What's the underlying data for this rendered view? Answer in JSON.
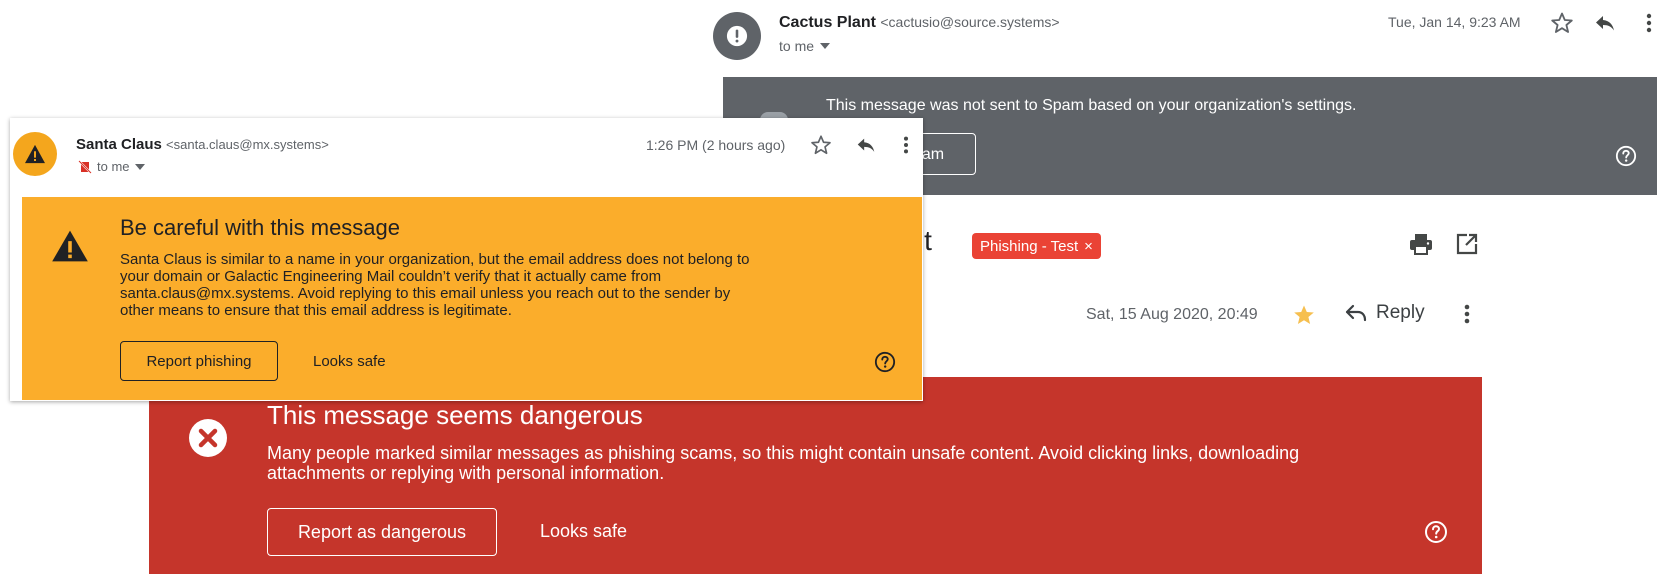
{
  "back_email": {
    "sender_name": "Cactus Plant",
    "sender_address": "<cactusio@source.systems>",
    "recipient": "to me",
    "date": "Tue, Jan 14, 9:23 AM",
    "notice": {
      "text": "This message was not sent to Spam based on your organization's settings.",
      "button_label": "pam"
    }
  },
  "middle_email": {
    "subject_fragment": "unt",
    "label": "Phishing - Test",
    "label_close": "×",
    "date": "Sat, 15 Aug 2020, 20:49",
    "reply_label": "Reply"
  },
  "danger_banner": {
    "title": "This message seems dangerous",
    "body": "Many people marked similar messages as phishing scams, so this might contain unsafe content. Avoid clicking links, downloading attachments or replying with personal information.",
    "report_label": "Report as dangerous",
    "safe_label": "Looks safe"
  },
  "front_email": {
    "sender_name": "Santa Claus",
    "sender_address": "<santa.claus@mx.systems>",
    "recipient": "to me",
    "date": "1:26 PM (2 hours ago)",
    "warning": {
      "title": "Be careful with this message",
      "body": "Santa Claus is similar to a name in your organization, but the email address does not belong to your domain or Galactic Engineering Mail couldn’t verify that it actually came from santa.claus@mx.systems. Avoid replying to this email unless you reach out to the sender by other means to ensure that this email address is legitimate.",
      "report_label": "Report phishing",
      "safe_label": "Looks safe"
    }
  },
  "colors": {
    "warning_yellow": "#fbad2b",
    "danger_red": "#c5352b",
    "spam_grey": "#5f6368",
    "label_red": "#ea4335",
    "star_gold": "#f6bf4f"
  },
  "icons": [
    "alert-circle-icon",
    "warning-triangle-icon",
    "star-outline-icon",
    "star-filled-icon",
    "reply-icon",
    "more-vert-icon",
    "help-icon",
    "print-icon",
    "open-in-new-icon",
    "close-circle-icon",
    "chevron-down-icon",
    "unverified-icon"
  ]
}
